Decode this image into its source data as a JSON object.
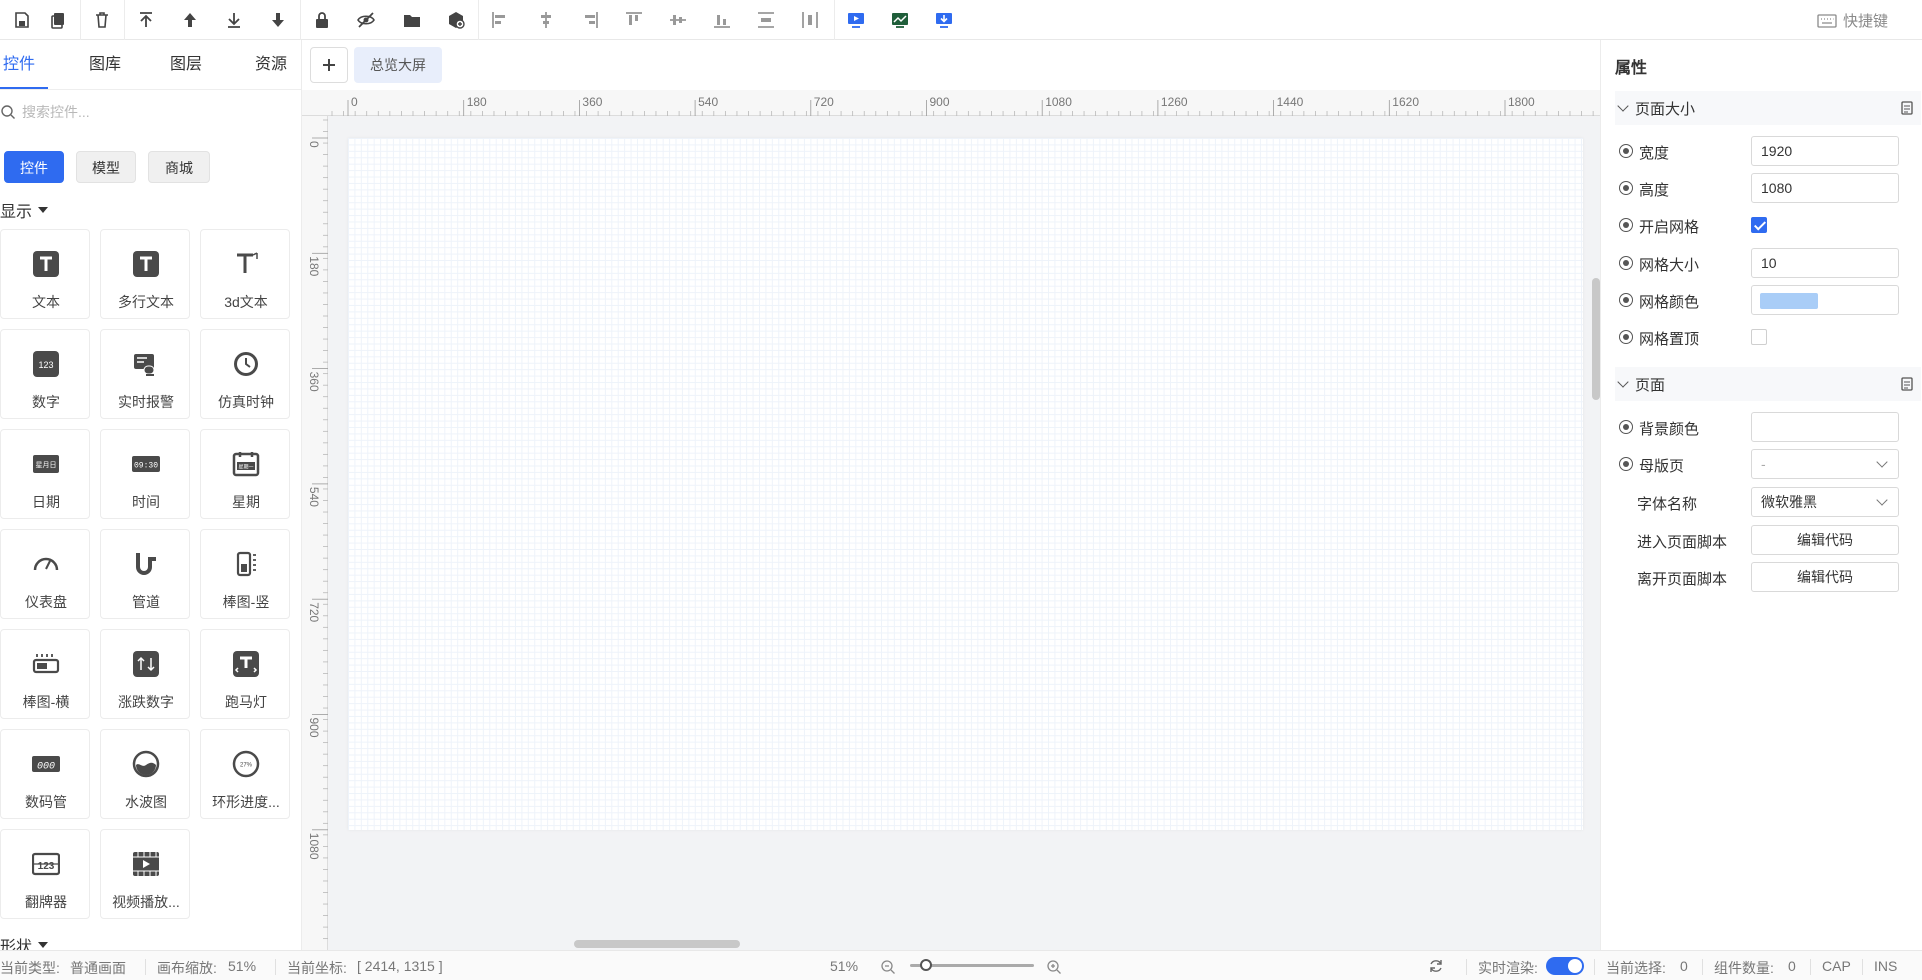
{
  "toolbar": {
    "shortcut_label": "快捷键"
  },
  "left": {
    "tabs": [
      {
        "label": "控件"
      },
      {
        "label": "图库"
      },
      {
        "label": "图层"
      },
      {
        "label": "资源"
      }
    ],
    "search_placeholder": "搜索控件...",
    "categories": [
      {
        "label": "控件"
      },
      {
        "label": "模型"
      },
      {
        "label": "商城"
      }
    ],
    "section_display": "显示",
    "section_shape": "形状",
    "widgets": [
      {
        "label": "文本",
        "icon": "text-icon"
      },
      {
        "label": "多行文本",
        "icon": "multiline-text-icon"
      },
      {
        "label": "3d文本",
        "icon": "3d-text-icon"
      },
      {
        "label": "数字",
        "icon": "number-icon"
      },
      {
        "label": "实时报警",
        "icon": "alarm-icon"
      },
      {
        "label": "仿真时钟",
        "icon": "clock-icon"
      },
      {
        "label": "日期",
        "icon": "date-icon"
      },
      {
        "label": "时间",
        "icon": "time-icon"
      },
      {
        "label": "星期",
        "icon": "week-icon"
      },
      {
        "label": "仪表盘",
        "icon": "gauge-icon"
      },
      {
        "label": "管道",
        "icon": "pipe-icon"
      },
      {
        "label": "棒图-竖",
        "icon": "vertical-bar-icon"
      },
      {
        "label": "棒图-横",
        "icon": "horizontal-bar-icon"
      },
      {
        "label": "涨跌数字",
        "icon": "rise-fall-number-icon"
      },
      {
        "label": "跑马灯",
        "icon": "marquee-icon"
      },
      {
        "label": "数码管",
        "icon": "digital-tube-icon"
      },
      {
        "label": "水波图",
        "icon": "water-wave-icon"
      },
      {
        "label": "环形进度...",
        "icon": "ring-progress-icon"
      },
      {
        "label": "翻牌器",
        "icon": "flip-counter-icon"
      },
      {
        "label": "视频播放...",
        "icon": "video-player-icon"
      }
    ],
    "widget_icon_text": {
      "number": "123",
      "date": "星月日",
      "time": "09:30",
      "week": "星期一",
      "digital": "000",
      "ring": "27%",
      "flip": "123"
    }
  },
  "canvas": {
    "page_tab": "总览大屏",
    "ruler_x": [
      "0",
      "180",
      "360",
      "540",
      "720",
      "900",
      "1080",
      "1260",
      "1440",
      "1620",
      "1800"
    ],
    "ruler_y": [
      "0",
      "180",
      "360",
      "540",
      "720",
      "900",
      "1080"
    ]
  },
  "right": {
    "title": "属性",
    "page_size_group": "页面大小",
    "width_label": "宽度",
    "width_value": "1920",
    "height_label": "高度",
    "height_value": "1080",
    "grid_on_label": "开启网格",
    "grid_on": true,
    "grid_size_label": "网格大小",
    "grid_size_value": "10",
    "grid_color_label": "网格颜色",
    "grid_color": "#a9cdf7",
    "grid_top_label": "网格置顶",
    "grid_top": false,
    "page_group": "页面",
    "bg_color_label": "背景颜色",
    "master_label": "母版页",
    "master_value": "-",
    "font_label": "字体名称",
    "font_value": "微软雅黑",
    "enter_script_label": "进入页面脚本",
    "leave_script_label": "离开页面脚本",
    "edit_code": "编辑代码"
  },
  "status": {
    "type_label": "当前类型:",
    "type_value": "普通画面",
    "zoom_label": "画布缩放:",
    "zoom_value": "51%",
    "coord_label": "当前坐标:",
    "coord_value": "[ 2414, 1315 ]",
    "zoom_center": "51%",
    "render_label": "实时渲染:",
    "selection_label": "当前选择:",
    "selection_value": "0",
    "count_label": "组件数量:",
    "count_value": "0",
    "cap": "CAP",
    "ins": "INS"
  },
  "colors": {
    "accent": "#2f6bf0"
  }
}
